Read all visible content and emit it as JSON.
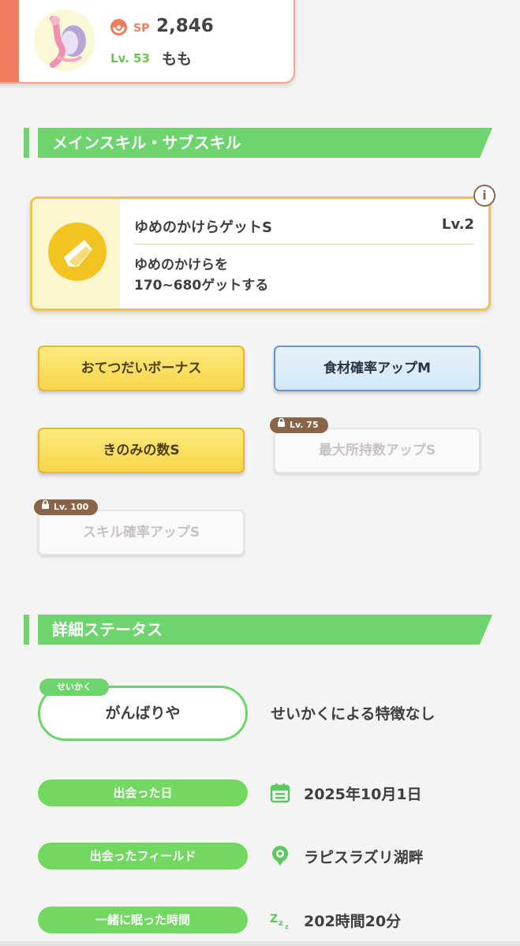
{
  "top": {
    "sp_label": "SP",
    "sp_value": "2,846",
    "level_label": "Lv. 53",
    "name": "もも"
  },
  "sections": {
    "skills_title": "メインスキル・サブスキル",
    "status_title": "詳細ステータス"
  },
  "main_skill": {
    "name": "ゆめのかけらゲットS",
    "level": "Lv.2",
    "desc_line1": "ゆめのかけらを",
    "desc_line2": "170~680ゲットする",
    "info_label": "i"
  },
  "sub_skills": [
    {
      "label": "おてつだいボーナス",
      "style": "gold"
    },
    {
      "label": "食材確率アップM",
      "style": "blue"
    },
    {
      "label": "きのみの数S",
      "style": "gold"
    },
    {
      "label": "最大所持数アップS",
      "style": "locked",
      "unlock": "Lv. 75"
    },
    {
      "label": "スキル確率アップS",
      "style": "locked",
      "unlock": "Lv. 100"
    }
  ],
  "details": {
    "nature_tag": "せいかく",
    "nature": "がんばりや",
    "nature_effect": "せいかくによる特徴なし",
    "met_date_label": "出会った日",
    "met_date": "2025年10月1日",
    "met_field_label": "出会ったフィールド",
    "met_field": "ラピスラズリ湖畔",
    "slept_label": "一緒に眠った時間",
    "slept_time": "202時間20分"
  },
  "colors": {
    "accent_orange": "#ee7c5e",
    "accent_green": "#6ed56e",
    "gold_border": "#f0c44a",
    "blue_border": "#5c97dc",
    "lock_brown": "#8a6449"
  },
  "icons": [
    "pokeball-icon",
    "dream-shard-icon",
    "info-icon",
    "lock-icon",
    "calendar-icon",
    "location-pin-icon",
    "sleep-zzz-icon"
  ]
}
